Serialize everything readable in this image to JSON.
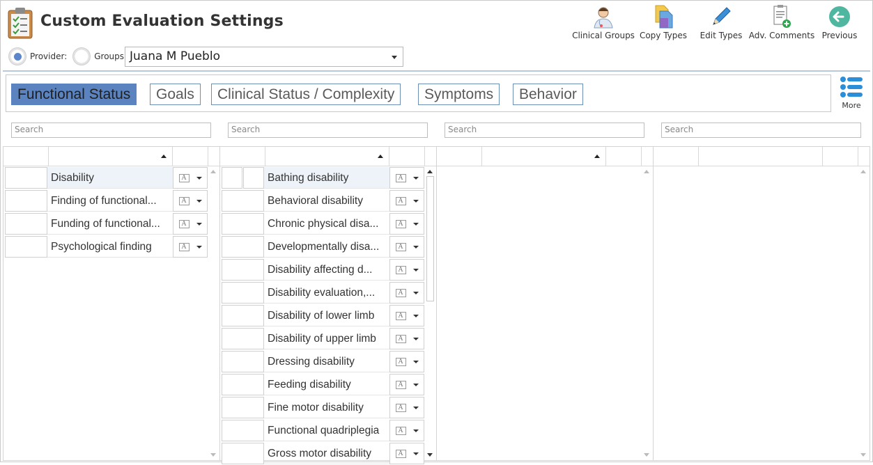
{
  "header": {
    "title": "Custom Evaluation Settings",
    "provider_label": "Provider:",
    "groups_label": "Groups:",
    "selected_provider": "Juana M Pueblo"
  },
  "toolbar": [
    {
      "label": "Clinical Groups",
      "icon": "doctor-icon"
    },
    {
      "label": "Copy Types",
      "icon": "copy-icon"
    },
    {
      "label": "Edit Types",
      "icon": "pencil-icon"
    },
    {
      "label": "Adv. Comments",
      "icon": "document-add-icon"
    },
    {
      "label": "Previous",
      "icon": "back-arrow-icon"
    }
  ],
  "tabs": [
    {
      "label": "Functional Status",
      "active": true
    },
    {
      "label": "Goals"
    },
    {
      "label": "Clinical Status / Complexity"
    },
    {
      "label": "Symptoms"
    },
    {
      "label": "Behavior"
    }
  ],
  "more_label": "More",
  "search_placeholder": "Search",
  "panel1_items": [
    "Disability",
    "Finding of functional...",
    "Funding of functional...",
    "Psychological finding"
  ],
  "panel2_items": [
    "Bathing disability",
    "Behavioral disability",
    "Chronic physical disa...",
    "Developmentally disa...",
    "Disability  affecting d...",
    "Disability evaluation,...",
    "Disability of lower limb",
    "Disability of upper limb",
    "Dressing disability",
    "Feeding disability",
    "Fine motor disability",
    "Functional quadriplegia",
    "Gross motor disability"
  ],
  "colors": {
    "accent": "#5a83bf",
    "tab_border": "#6d8fb3",
    "separator": "#b9c9dd"
  }
}
